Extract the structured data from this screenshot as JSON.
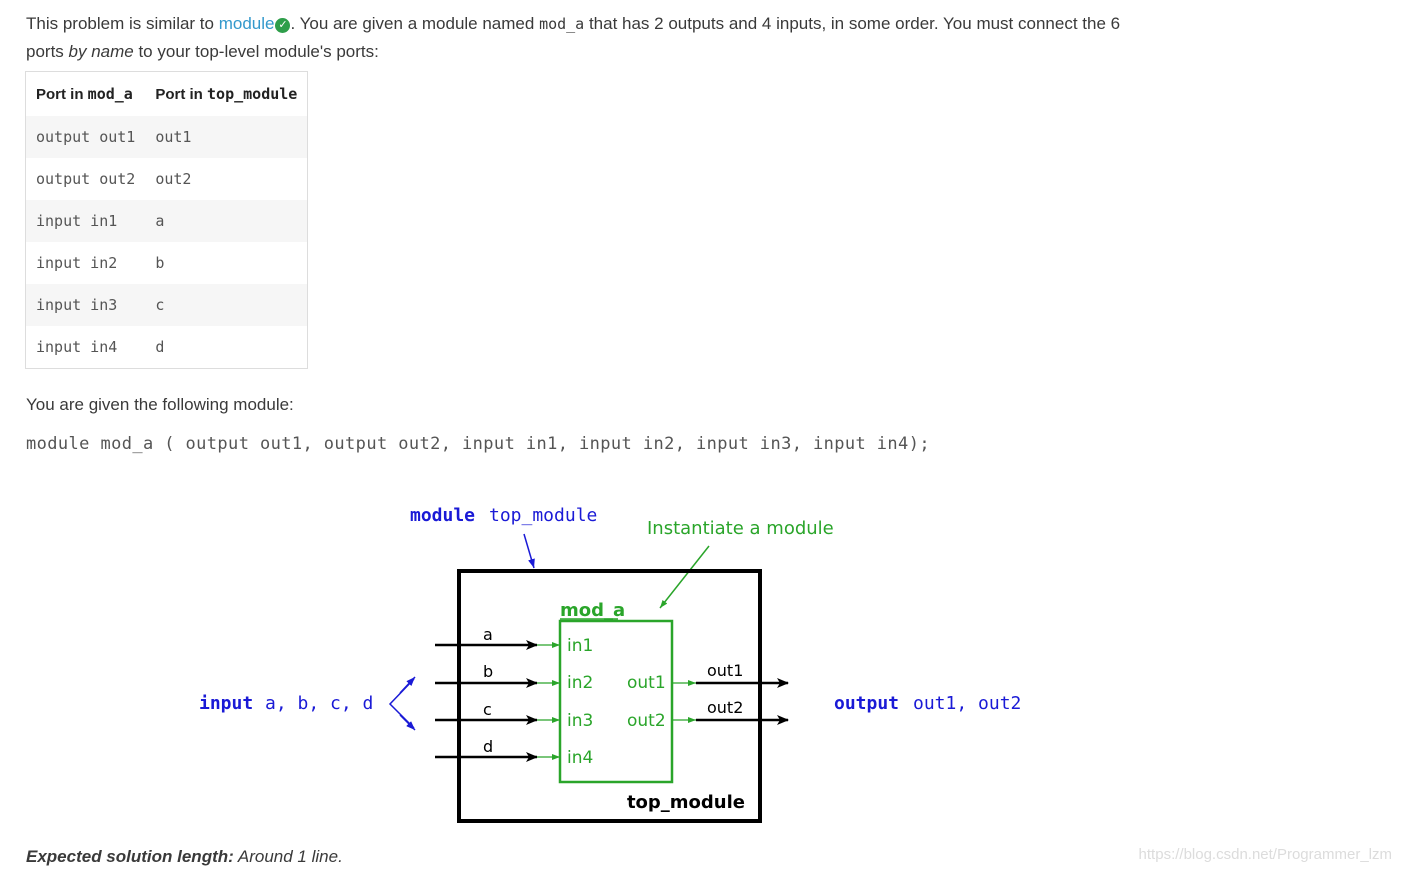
{
  "intro": {
    "part1": "This problem is similar to ",
    "link": "module",
    "check_icon": "check-circle-icon",
    "part2": ". You are given a module named ",
    "code_mod": "mod_a",
    "part3": " that has 2 outputs and 4 inputs, in some order. You must connect the 6",
    "part4": "ports ",
    "by_name": "by name",
    "part5": " to your top-level module's ports:"
  },
  "table": {
    "header_col1_text": "Port in ",
    "header_col1_code": "mod_a",
    "header_col2_text": "Port in ",
    "header_col2_code": "top_module",
    "rows": [
      {
        "a": "output out1",
        "b": "out1"
      },
      {
        "a": "output out2",
        "b": "out2"
      },
      {
        "a": "input in1",
        "b": "a"
      },
      {
        "a": "input in2",
        "b": "b"
      },
      {
        "a": "input in3",
        "b": "c"
      },
      {
        "a": "input in4",
        "b": "d"
      }
    ]
  },
  "given_text": "You are given the following module:",
  "code_line": "module mod_a ( output out1, output out2, input in1, input in2, input in3, input in4);",
  "diagram": {
    "kw_module": "module",
    "top_name": "top_module",
    "instantiate": "Instantiate a module",
    "mod_label": "mod_a",
    "wire_a": "a",
    "wire_b": "b",
    "wire_c": "c",
    "wire_d": "d",
    "in1": "in1",
    "in2": "in2",
    "in3": "in3",
    "in4": "in4",
    "out1": "out1",
    "out2": "out2",
    "out1_wire": "out1",
    "out2_wire": "out2",
    "top_label": "top_module",
    "input_kw": "input",
    "input_names": "a, b, c, d",
    "output_kw": "output",
    "output_names": "out1, out2",
    "colors": {
      "blue": "#1a1ad6",
      "green": "#2aa52a",
      "black": "#000000"
    }
  },
  "footer": {
    "label": "Expected solution length:",
    "value": " Around 1 line."
  },
  "watermark": "https://blog.csdn.net/Programmer_lzm"
}
